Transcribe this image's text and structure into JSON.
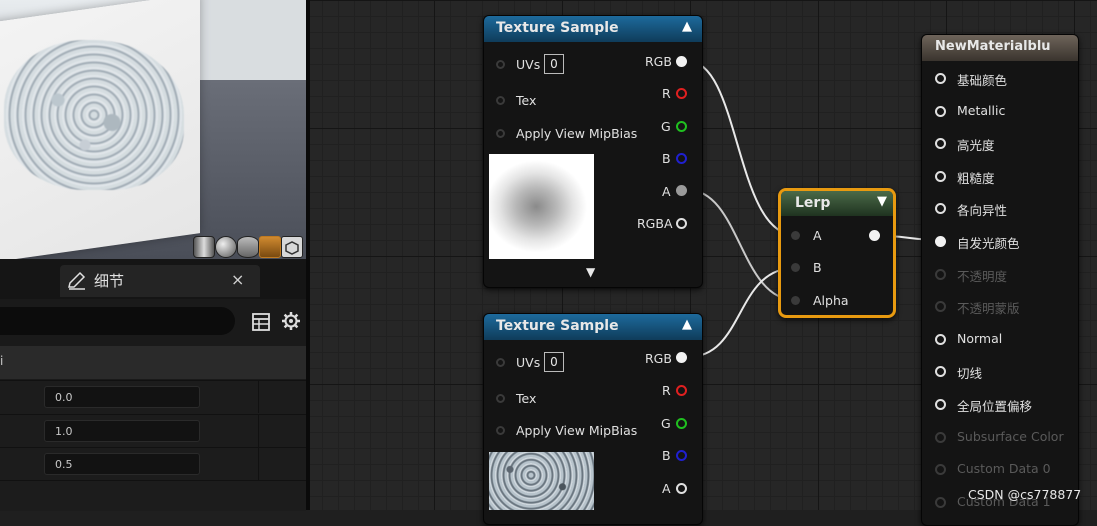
{
  "details": {
    "tab_title": "细节",
    "close_label": "×",
    "section_label": "i",
    "properties": [
      {
        "value": "0.0"
      },
      {
        "value": "1.0"
      },
      {
        "value": "0.5"
      }
    ]
  },
  "nodes": {
    "texture_sample_1": {
      "title": "Texture Sample",
      "inputs": [
        "UVs",
        "Tex",
        "Apply View MipBias"
      ],
      "uv_value": "0",
      "outputs": [
        "RGB",
        "R",
        "G",
        "B",
        "A",
        "RGBA"
      ],
      "expand_icon": "chevron-down-icon"
    },
    "texture_sample_2": {
      "title": "Texture Sample",
      "inputs": [
        "UVs",
        "Tex",
        "Apply View MipBias"
      ],
      "uv_value": "0",
      "outputs": [
        "RGB",
        "R",
        "G",
        "B",
        "A"
      ]
    },
    "lerp": {
      "title": "Lerp",
      "inputs": [
        "A",
        "B",
        "Alpha"
      ]
    },
    "material": {
      "title": "NewMaterialblu",
      "pins": [
        "基础颜色",
        "Metallic",
        "高光度",
        "粗糙度",
        "各向异性",
        "自发光颜色",
        "不透明度",
        "不透明蒙版",
        "Normal",
        "切线",
        "全局位置偏移",
        "Subsurface Color",
        "Custom Data 0",
        "Custom Data 1"
      ]
    }
  },
  "colors": {
    "pin_r": "#e02020",
    "pin_g": "#20c020",
    "pin_b": "#2020d0",
    "lerp_border": "#e89a10",
    "texture_header": "#1d6a9c"
  },
  "watermark": "CSDN @cs778877"
}
